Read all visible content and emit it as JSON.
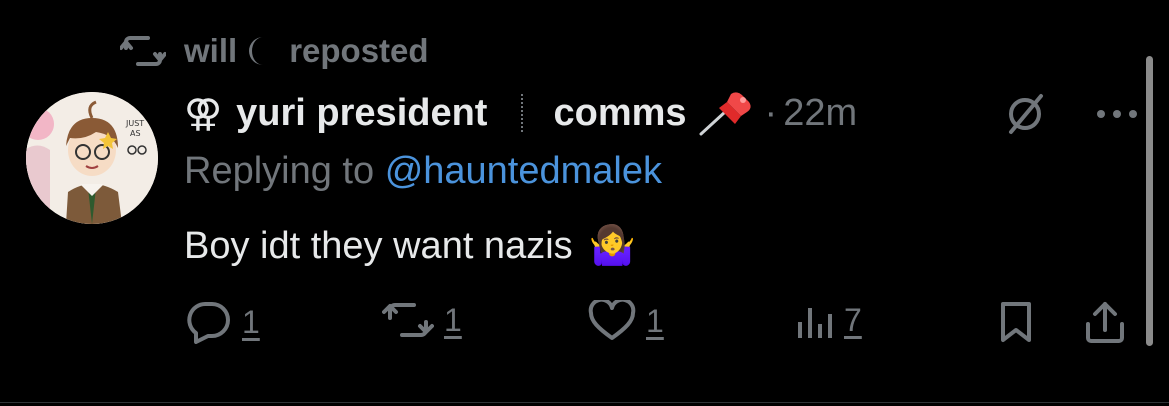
{
  "repost": {
    "user": "will",
    "action": "reposted",
    "icon": "repost-icon",
    "moon_icon": "crescent-moon-icon"
  },
  "author": {
    "avatar_icon": "avatar",
    "symbol": "⚢",
    "name": "yuri president",
    "badge": "comms",
    "badge_icon": "pushpin-icon",
    "dot": "·",
    "time": "22m"
  },
  "reply": {
    "prefix": "Replying to",
    "handle": "@hauntedmalek"
  },
  "tweet": {
    "text": "Boy idt they want nazis",
    "emoji": "🤷‍♀️"
  },
  "actions": {
    "reply_count": "1",
    "repost_count": "1",
    "like_count": "1",
    "views_count": "7"
  },
  "colors": {
    "background": "#000000",
    "text": "#e7e9ea",
    "muted": "#71767b",
    "link": "#4b93dc"
  }
}
